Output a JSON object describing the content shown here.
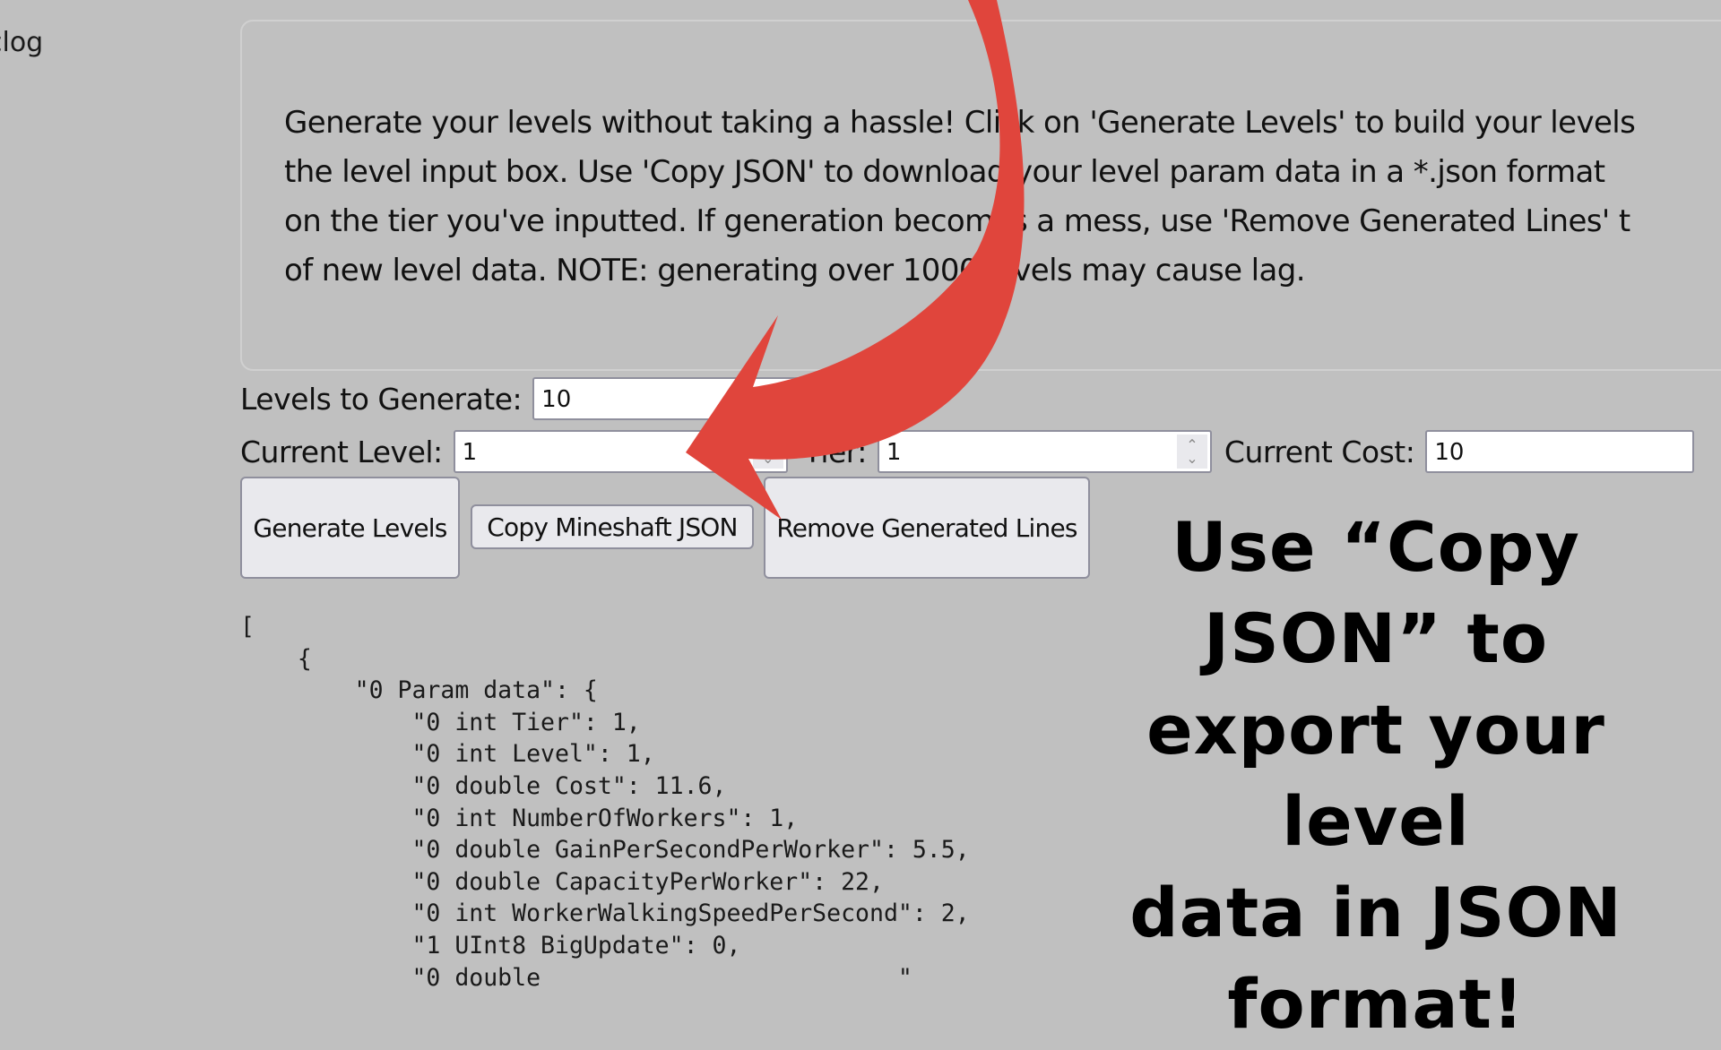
{
  "nav": {
    "partial_link": "clog"
  },
  "info": {
    "lines": [
      "Generate your levels without taking a hassle! Click on 'Generate Levels' to build your levels",
      "the level input box. Use 'Copy JSON' to download your level param data in a *.json format",
      "on the tier you've inputted. If generation becomes a mess, use 'Remove Generated Lines' t",
      "of new level data. NOTE: generating over 1000 levels may cause lag."
    ]
  },
  "form": {
    "levels_to_generate": {
      "label": "Levels to Generate:",
      "value": "10"
    },
    "current_level": {
      "label": "Current Level:",
      "value": "1"
    },
    "tier": {
      "label": "Tier:",
      "value": "1"
    },
    "current_cost": {
      "label": "Current Cost:",
      "value": "10"
    }
  },
  "buttons": {
    "generate": "Generate Levels",
    "copy_json": "Copy Mineshaft JSON",
    "remove": "Remove Generated Lines"
  },
  "json_output": {
    "lines": [
      "[",
      "    {",
      "        \"0 Param data\": {",
      "            \"0 int Tier\": 1,",
      "            \"0 int Level\": 1,",
      "            \"0 double Cost\": 11.6,",
      "            \"0 int NumberOfWorkers\": 1,",
      "            \"0 double GainPerSecondPerWorker\": 5.5,",
      "            \"0 double CapacityPerWorker\": 22,",
      "            \"0 int WorkerWalkingSpeedPerSecond\": 2,",
      "            \"1 UInt8 BigUpdate\": 0,",
      "            \"0 double                         \""
    ]
  },
  "callout": {
    "lines": [
      "Use “Copy",
      "JSON” to",
      "export your level",
      "data in JSON",
      "format!"
    ]
  },
  "colors": {
    "background": "#c0c0c0",
    "arrow": "#e0453c",
    "button_bg": "#e9e9ed",
    "field_border": "#8f8f9d"
  },
  "icons": {
    "spin_up": "⌃",
    "spin_down": "⌄"
  }
}
